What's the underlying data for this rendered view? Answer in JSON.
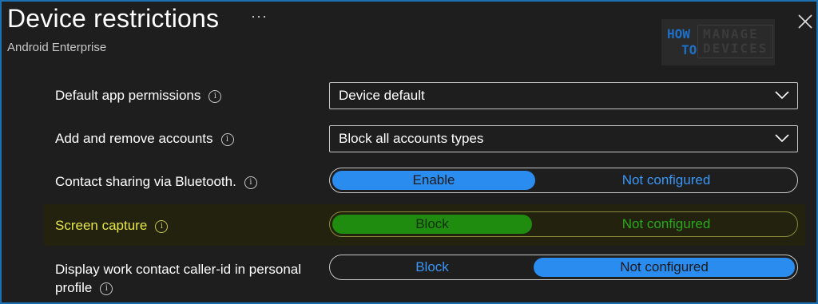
{
  "header": {
    "title": "Device restrictions",
    "subtitle": "Android Enterprise",
    "more_label": "···"
  },
  "logo": {
    "how": "HOW",
    "to": "TO",
    "manage": "MANAGE",
    "devices": "DEVICES"
  },
  "settings": [
    {
      "label": "Default app permissions",
      "type": "select",
      "value": "Device default"
    },
    {
      "label": "Add and remove accounts",
      "type": "select",
      "value": "Block all accounts types"
    },
    {
      "label": "Contact sharing via Bluetooth.",
      "type": "toggle",
      "options": [
        "Enable",
        "Not configured"
      ],
      "selected": "Enable"
    },
    {
      "label": "Screen capture",
      "type": "toggle",
      "options": [
        "Block",
        "Not configured"
      ],
      "selected": "Block",
      "highlighted": true
    },
    {
      "label_line1": "Display work contact caller-id in personal",
      "label_line2": "profile",
      "type": "toggle",
      "options": [
        "Block",
        "Not configured"
      ],
      "selected": "Not configured"
    }
  ],
  "colors": {
    "accent_blue": "#2b8cf0",
    "selected_green": "#1f8c0f",
    "highlight_bg": "#22220f",
    "highlight_text": "#e6e64a"
  }
}
